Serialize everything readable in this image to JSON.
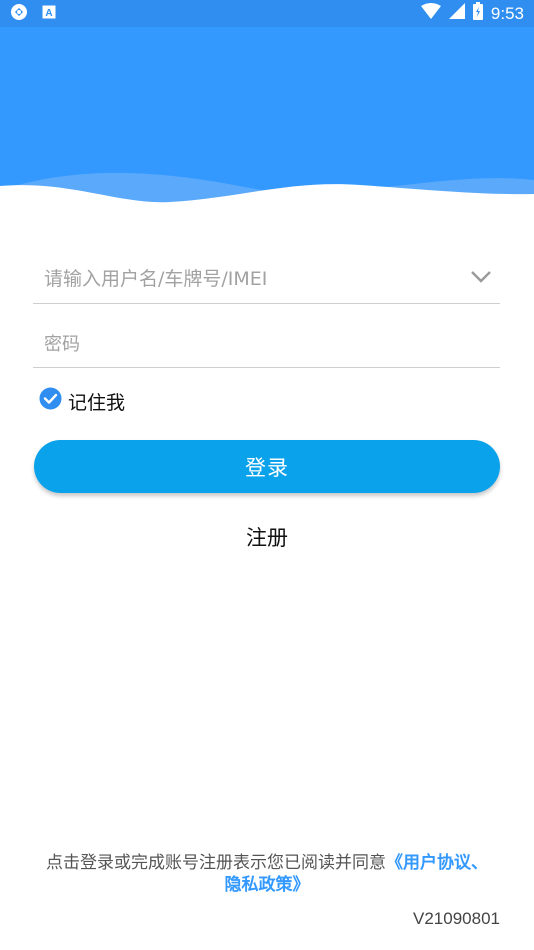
{
  "status_bar": {
    "time": "9:53",
    "left_icons": [
      "sync-icon",
      "keyboard-a-icon"
    ],
    "right_icons": [
      "wifi-icon",
      "signal-icon",
      "battery-icon"
    ]
  },
  "colors": {
    "header": "#3399ff",
    "button": "#0aa2ea",
    "link": "#3399ff"
  },
  "login_form": {
    "username_placeholder": "请输入用户名/车牌号/IMEI",
    "password_placeholder": "密码",
    "remember_label": "记住我",
    "remember_checked": true,
    "login_label": "登录",
    "register_label": "注册"
  },
  "footer": {
    "agreement_text": "点击登录或完成账号注册表示您已阅读并同意",
    "agreement_link_1": "《用户协议、",
    "agreement_link_2": "隐私政策》",
    "version": "V21090801"
  }
}
